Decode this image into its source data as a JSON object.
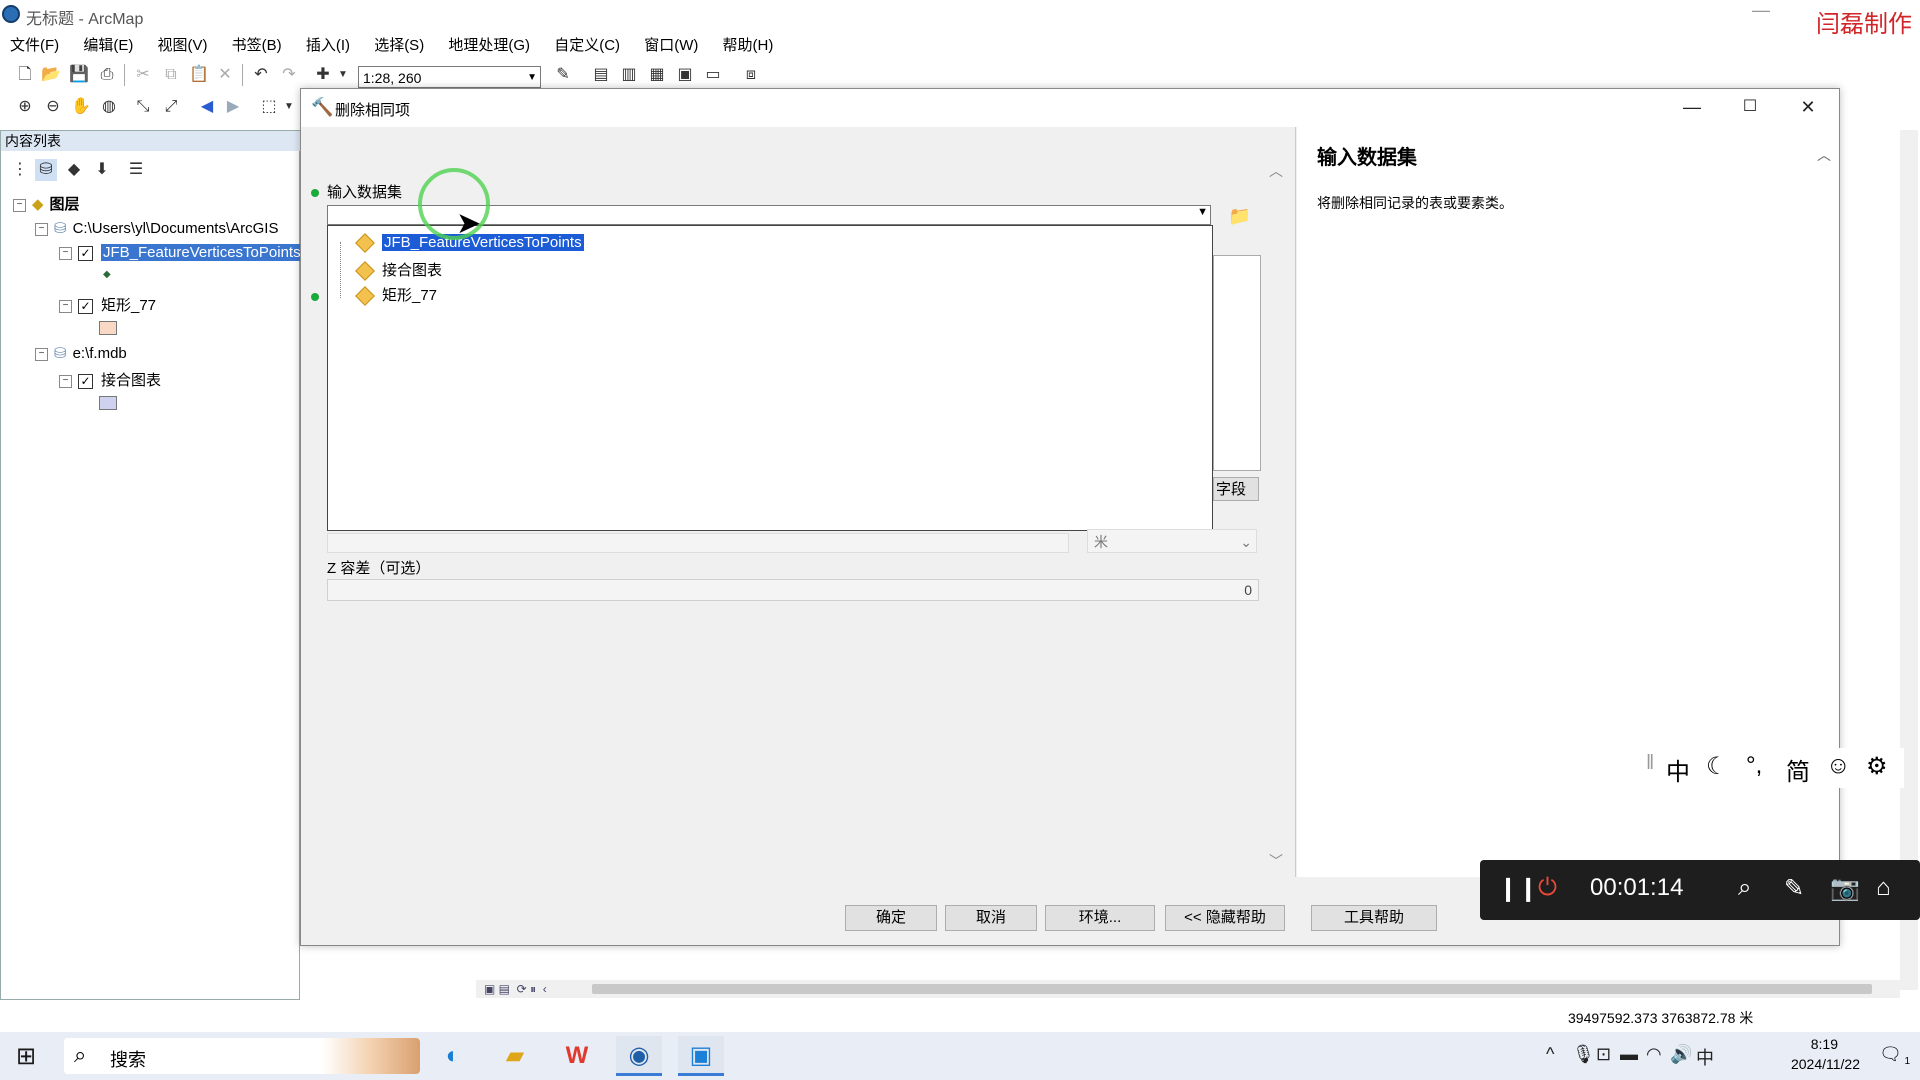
{
  "app": {
    "title": "无标题 - ArcMap",
    "watermark": "闫磊制作"
  },
  "menu": [
    "文件(F)",
    "编辑(E)",
    "视图(V)",
    "书签(B)",
    "插入(I)",
    "选择(S)",
    "地理处理(G)",
    "自定义(C)",
    "窗口(W)",
    "帮助(H)"
  ],
  "toolbar": {
    "scale": "1:28, 260"
  },
  "toc": {
    "header": "内容列表",
    "root": "图层",
    "group1": "C:\\Users\\yl\\Documents\\ArcGIS",
    "layer1": "JFB_FeatureVerticesToPoints",
    "layer2": "矩形_77",
    "group2": "e:\\f.mdb",
    "layer3": "接合图表"
  },
  "dialog": {
    "title": "删除相同项",
    "input_label": "输入数据集",
    "dropdown_items": [
      "JFB_FeatureVerticesToPoints",
      "接合图表",
      "矩形_77"
    ],
    "fields_button": "字段",
    "unit_placeholder": "米",
    "z_label": "Z 容差（可选）",
    "z_value": "0",
    "help_title": "输入数据集",
    "help_text": "将删除相同记录的表或要素类。",
    "buttons": {
      "ok": "确定",
      "cancel": "取消",
      "env": "环境...",
      "hide_help": "<< 隐藏帮助",
      "tool_help": "工具帮助"
    }
  },
  "status": {
    "coords": "39497592.373  3763872.78 米"
  },
  "ime": {
    "lang": "中",
    "simp": "简"
  },
  "recorder": {
    "time": "00:01:14"
  },
  "taskbar": {
    "search": "搜索",
    "time": "8:19",
    "date": "2024/11/22",
    "ime": "中",
    "notif_count": "1"
  }
}
